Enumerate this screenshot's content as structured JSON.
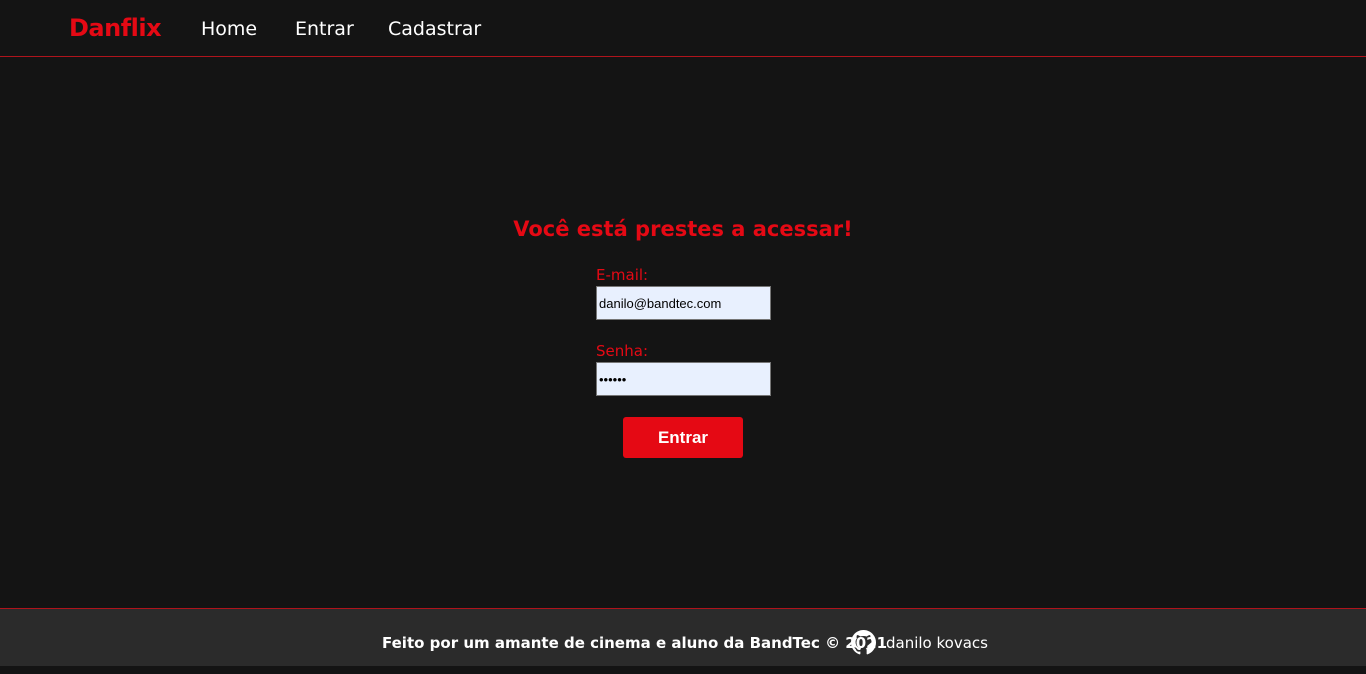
{
  "nav": {
    "brand": "Danflix",
    "links": [
      "Home",
      "Entrar",
      "Cadastrar"
    ]
  },
  "login": {
    "title": "Você está prestes a acessar!",
    "email_label": "E-mail:",
    "email_value": "danilo@bandtec.com",
    "password_label": "Senha:",
    "password_value": "••••••",
    "submit_label": "Entrar"
  },
  "footer": {
    "text": "Feito por um amante de cinema e aluno da BandTec © 2021",
    "icon": "github-icon",
    "author": "danilo kovacs"
  },
  "colors": {
    "background": "#141414",
    "accent": "#e50914",
    "footer_bg": "#2b2b2b",
    "input_bg": "#e8f0fe"
  }
}
